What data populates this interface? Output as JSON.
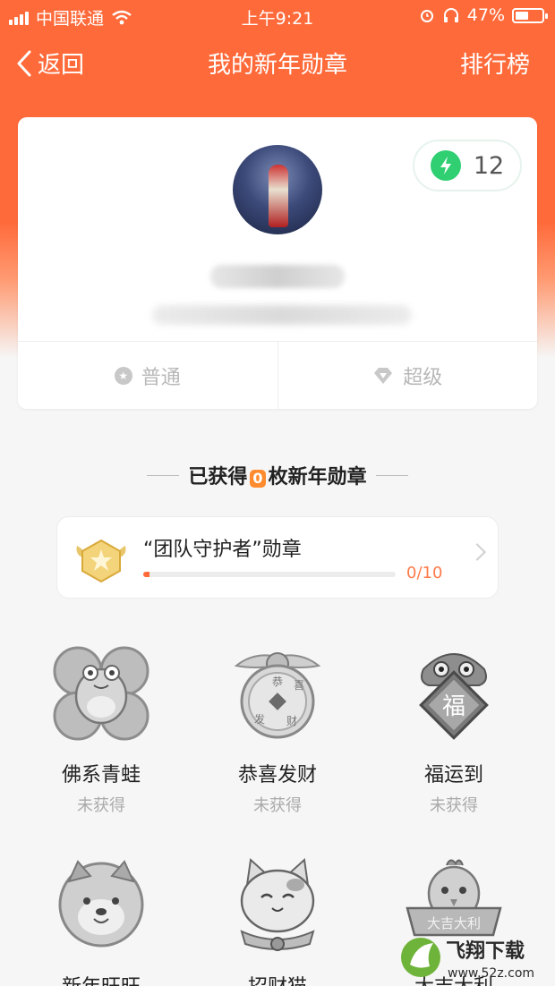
{
  "status_bar": {
    "carrier": "中国联通",
    "time": "上午9:21",
    "battery": "47%"
  },
  "nav": {
    "back_label": "返回",
    "title": "我的新年勋章",
    "right_label": "排行榜"
  },
  "profile": {
    "energy_count": "12",
    "tabs": [
      {
        "label": "普通",
        "icon": "star-icon"
      },
      {
        "label": "超级",
        "icon": "diamond-icon"
      }
    ]
  },
  "earned": {
    "prefix": "已获得",
    "count": "0",
    "suffix": "枚新年勋章"
  },
  "progress_card": {
    "title": "“团队守护者”勋章",
    "progress_text": "0/10",
    "progress_fraction": 0.0
  },
  "badges": [
    {
      "name": "佛系青蛙",
      "status": "未获得",
      "icon": "frog-icon"
    },
    {
      "name": "恭喜发财",
      "status": "未获得",
      "icon": "coin-icon"
    },
    {
      "name": "福运到",
      "status": "未获得",
      "icon": "lion-fu-icon"
    },
    {
      "name": "新年旺旺",
      "status": "",
      "icon": "dog-icon"
    },
    {
      "name": "招财猫",
      "status": "",
      "icon": "lucky-cat-icon"
    },
    {
      "name": "大吉大利",
      "status": "",
      "icon": "chicken-icon"
    }
  ],
  "badge_art_text": {
    "coin_chars": [
      "恭",
      "喜",
      "发",
      "财"
    ],
    "fu_char": "福",
    "banner_text": "大吉大利"
  },
  "watermark": {
    "brand": "飞翔下载",
    "url": "www.52z.com"
  },
  "colors": {
    "brand_orange": "#ff6a3a",
    "energy_green": "#2fcf72",
    "count_orange": "#ff8b2e"
  }
}
